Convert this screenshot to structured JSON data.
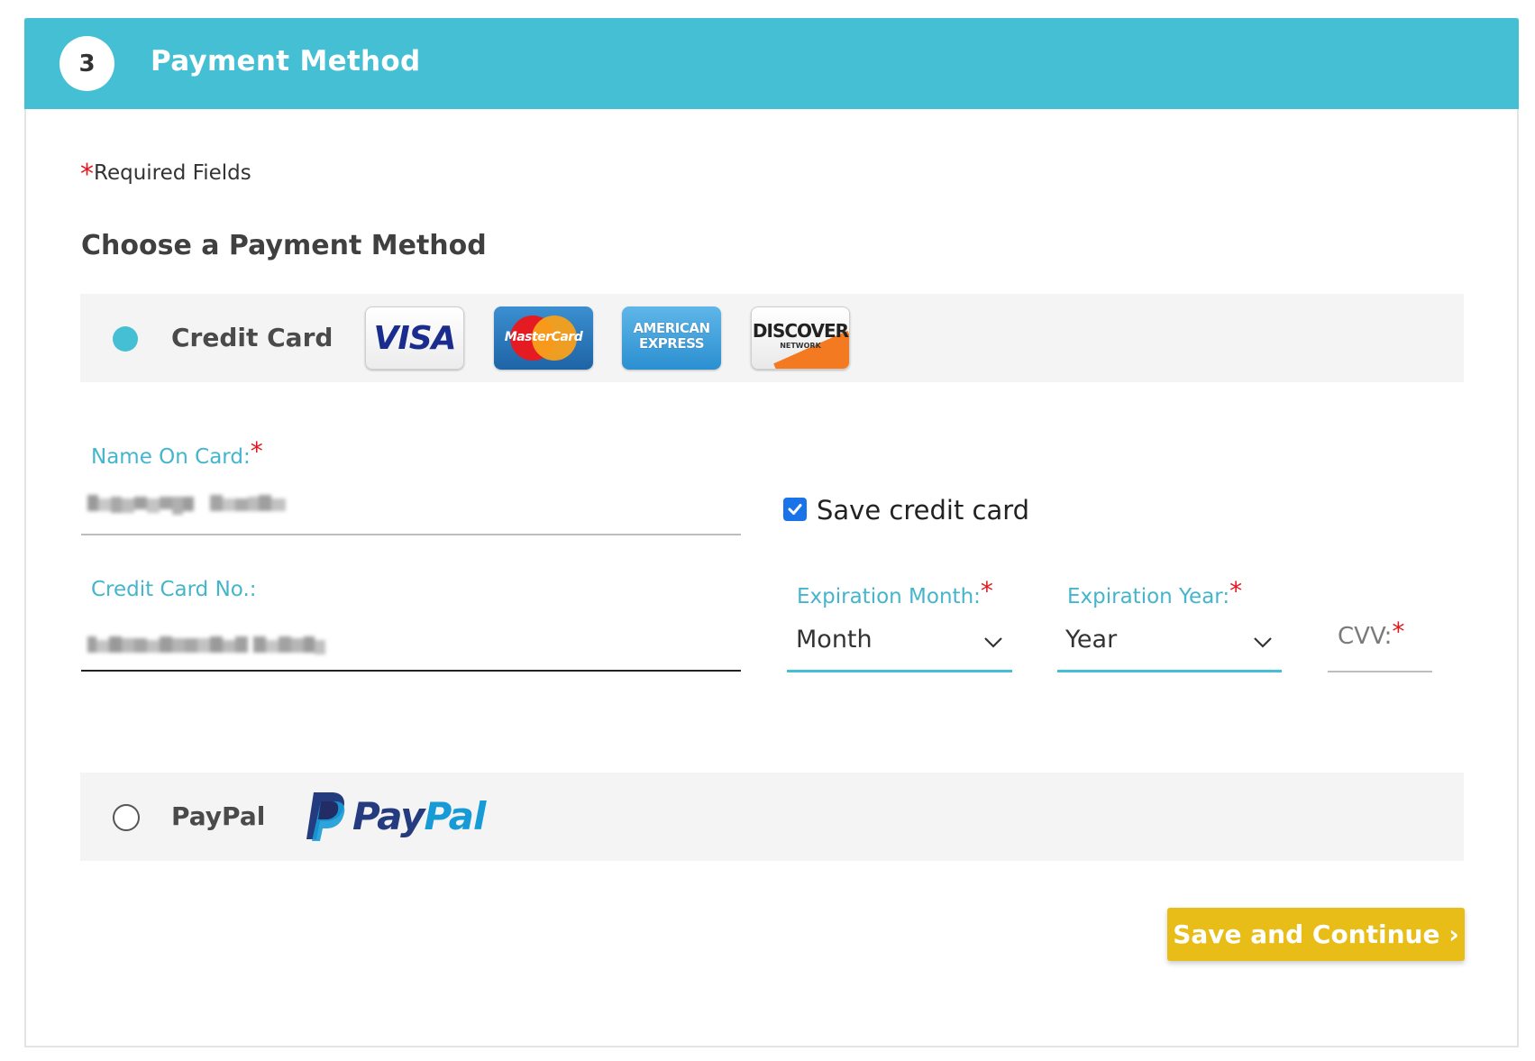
{
  "header": {
    "step_number": "3",
    "title": "Payment Method",
    "color": "#45bfd3"
  },
  "required_note": {
    "star": "*",
    "text": "Required Fields"
  },
  "section_title": "Choose a Payment Method",
  "credit_card_option": {
    "label": "Credit Card",
    "selected": true,
    "cards": [
      {
        "name": "visa-icon",
        "text": "VISA"
      },
      {
        "name": "mastercard-icon",
        "text": "MasterCard"
      },
      {
        "name": "amex-icon",
        "text": "AMERICAN EXPRESS"
      },
      {
        "name": "discover-icon",
        "text": "DISCOVER",
        "subtext": "NETWORK"
      }
    ]
  },
  "form": {
    "name_on_card": {
      "label": "Name On Card:",
      "required_star": "*"
    },
    "credit_card_no": {
      "label": "Credit Card No.:"
    },
    "save_credit_card": {
      "label": "Save credit card",
      "checked": true
    },
    "expiration_month": {
      "label": "Expiration Month:",
      "required_star": "*",
      "value": "Month"
    },
    "expiration_year": {
      "label": "Expiration Year:",
      "required_star": "*",
      "value": "Year"
    },
    "cvv": {
      "label": "CVV:",
      "required_star": "*"
    }
  },
  "paypal_option": {
    "label": "PayPal",
    "selected": false,
    "logo_text_pay": "Pay",
    "logo_text_pal": "Pal"
  },
  "submit_button": {
    "label": "Save and Continue ›",
    "color": "#e8bd18"
  }
}
